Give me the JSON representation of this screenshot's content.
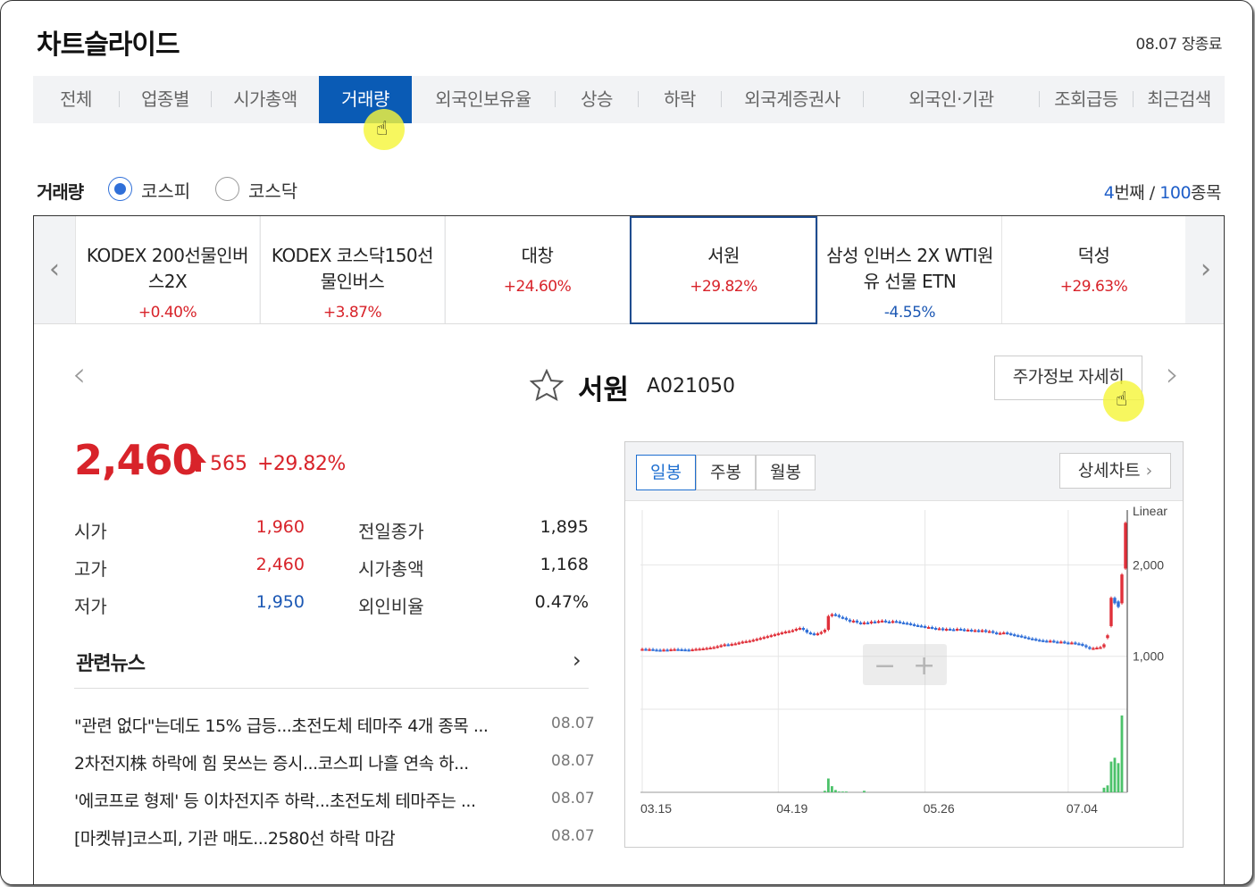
{
  "page_title": "차트슬라이드",
  "market_status": "08.07 장종료",
  "tabs": [
    {
      "label": "전체"
    },
    {
      "label": "업종별"
    },
    {
      "label": "시가총액"
    },
    {
      "label": "거래량",
      "active": true
    },
    {
      "label": "외국인보유율"
    },
    {
      "label": "상승"
    },
    {
      "label": "하락"
    },
    {
      "label": "외국계증권사"
    },
    {
      "label": "외국인·기관"
    },
    {
      "label": "조회급등"
    },
    {
      "label": "최근검색"
    }
  ],
  "filter": {
    "label": "거래량",
    "options": [
      {
        "label": "코스피",
        "checked": true
      },
      {
        "label": "코스닥",
        "checked": false
      }
    ],
    "rank_current": "4",
    "rank_suffix": "번째 / ",
    "rank_total": "100",
    "rank_unit": "종목"
  },
  "carousel": [
    {
      "name": "KODEX 200선물인버스2X",
      "change": "+0.40%",
      "dir": "up"
    },
    {
      "name": "KODEX 코스닥150선물인버스",
      "change": "+3.87%",
      "dir": "up"
    },
    {
      "name": "대창",
      "change": "+24.60%",
      "dir": "up"
    },
    {
      "name": "서원",
      "change": "+29.82%",
      "dir": "up",
      "selected": true
    },
    {
      "name": "삼성 인버스 2X WTI원유 선물 ETN",
      "change": "-4.55%",
      "dir": "down"
    },
    {
      "name": "덕성",
      "change": "+29.63%",
      "dir": "up"
    }
  ],
  "stock": {
    "name": "서원",
    "code": "A021050",
    "detail_button": "주가정보 자세히",
    "price": "2,460",
    "change_amount": "565",
    "change_pct": "+29.82%",
    "quotes": [
      {
        "label": "시가",
        "value": "1,960",
        "color": "up"
      },
      {
        "label": "고가",
        "value": "2,460",
        "color": "up"
      },
      {
        "label": "저가",
        "value": "1,950",
        "color": "down"
      },
      {
        "label": "전일종가",
        "value": "1,895",
        "color": "flat"
      },
      {
        "label": "시가총액",
        "value": "1,168",
        "color": "flat"
      },
      {
        "label": "외인비율",
        "value": "0.47%",
        "color": "flat"
      }
    ]
  },
  "news": {
    "heading": "관련뉴스",
    "items": [
      {
        "title": "\"관련 없다\"는데도 15% 급등...초전도체 테마주 4개 종목 ...",
        "date": "08.07"
      },
      {
        "title": "2차전지株 하락에 힘 못쓰는 증시...코스피 나흘 연속 하...",
        "date": "08.07"
      },
      {
        "title": "'에코프로 형제' 등 이차전지주 하락...초전도체 테마주는 ...",
        "date": "08.07"
      },
      {
        "title": "[마켓뷰]코스피, 기관 매도...2580선 하락 마감",
        "date": "08.07"
      }
    ]
  },
  "chart": {
    "periods": [
      "일봉",
      "주봉",
      "월봉"
    ],
    "active_period": "일봉",
    "detail_label": "상세차트",
    "scale_label": "Linear",
    "colors": {
      "up": "#e0303a",
      "down": "#2f6fd8",
      "volume": "#4cc26a"
    }
  },
  "chart_data": {
    "type": "candlestick",
    "x_ticks": [
      "03.15",
      "04.19",
      "05.26",
      "07.04"
    ],
    "y_ticks": [
      2000,
      1000
    ],
    "ylim": [
      450,
      2600
    ],
    "closes": [
      1080,
      1075,
      1078,
      1072,
      1070,
      1068,
      1072,
      1070,
      1075,
      1078,
      1076,
      1074,
      1072,
      1070,
      1075,
      1080,
      1082,
      1085,
      1090,
      1095,
      1100,
      1110,
      1120,
      1130,
      1125,
      1135,
      1140,
      1150,
      1160,
      1165,
      1170,
      1180,
      1190,
      1200,
      1210,
      1220,
      1230,
      1240,
      1250,
      1260,
      1270,
      1275,
      1285,
      1300,
      1310,
      1290,
      1260,
      1250,
      1240,
      1250,
      1265,
      1290,
      1440,
      1460,
      1450,
      1430,
      1420,
      1400,
      1380,
      1390,
      1370,
      1360,
      1370,
      1365,
      1380,
      1375,
      1385,
      1390,
      1380,
      1375,
      1385,
      1380,
      1370,
      1365,
      1360,
      1350,
      1340,
      1335,
      1330,
      1320,
      1320,
      1310,
      1300,
      1305,
      1290,
      1300,
      1295,
      1290,
      1300,
      1295,
      1285,
      1290,
      1280,
      1285,
      1275,
      1285,
      1270,
      1275,
      1260,
      1250,
      1255,
      1260,
      1250,
      1240,
      1230,
      1225,
      1215,
      1205,
      1195,
      1190,
      1180,
      1175,
      1170,
      1165,
      1170,
      1160,
      1155,
      1160,
      1150,
      1145,
      1150,
      1140,
      1135,
      1120,
      1100,
      1085,
      1090,
      1095,
      1100,
      1130,
      1230,
      1640,
      1580,
      1540,
      1895,
      2460
    ],
    "opens": [
      1075,
      1080,
      1075,
      1078,
      1072,
      1070,
      1068,
      1072,
      1070,
      1075,
      1078,
      1076,
      1074,
      1072,
      1070,
      1075,
      1080,
      1082,
      1085,
      1090,
      1095,
      1100,
      1110,
      1120,
      1130,
      1125,
      1135,
      1140,
      1150,
      1160,
      1165,
      1170,
      1180,
      1190,
      1200,
      1210,
      1220,
      1230,
      1240,
      1250,
      1260,
      1270,
      1275,
      1285,
      1300,
      1310,
      1290,
      1260,
      1250,
      1240,
      1250,
      1265,
      1290,
      1440,
      1460,
      1450,
      1430,
      1420,
      1400,
      1380,
      1390,
      1370,
      1360,
      1370,
      1365,
      1380,
      1375,
      1385,
      1390,
      1380,
      1375,
      1385,
      1380,
      1370,
      1365,
      1360,
      1350,
      1340,
      1335,
      1330,
      1320,
      1320,
      1310,
      1300,
      1305,
      1290,
      1300,
      1295,
      1290,
      1300,
      1295,
      1285,
      1290,
      1280,
      1285,
      1275,
      1285,
      1270,
      1275,
      1260,
      1250,
      1255,
      1260,
      1250,
      1240,
      1230,
      1225,
      1215,
      1205,
      1195,
      1190,
      1180,
      1175,
      1170,
      1165,
      1170,
      1160,
      1155,
      1160,
      1150,
      1145,
      1150,
      1140,
      1135,
      1120,
      1100,
      1085,
      1090,
      1095,
      1100,
      1200,
      1330,
      1640,
      1600,
      1580,
      1960
    ],
    "volumes": [
      0,
      0,
      0,
      0,
      0,
      0,
      0,
      0,
      0,
      0,
      0,
      0,
      0,
      0,
      0,
      0,
      0,
      0,
      0,
      0,
      0,
      0,
      0,
      0,
      0,
      0,
      0,
      0,
      0,
      0,
      0,
      0,
      0,
      0,
      0,
      0,
      0,
      0,
      0,
      0,
      0,
      0,
      0,
      0,
      0,
      0,
      0,
      0,
      0,
      0,
      0,
      2,
      18,
      8,
      3,
      1,
      1,
      1,
      0,
      0,
      0,
      0,
      2,
      0,
      0,
      0,
      0,
      0,
      0,
      0,
      0,
      0,
      0,
      0,
      0,
      0,
      0,
      0,
      0,
      0,
      0,
      0,
      0,
      0,
      0,
      0,
      0,
      0,
      0,
      0,
      0,
      0,
      0,
      0,
      0,
      0,
      0,
      0,
      0,
      0,
      0,
      0,
      0,
      0,
      0,
      0,
      0,
      0,
      0,
      0,
      0,
      0,
      0,
      0,
      0,
      0,
      0,
      0,
      0,
      0,
      0,
      0,
      0,
      0,
      0,
      0,
      0,
      0,
      0,
      6,
      9,
      40,
      45,
      38,
      100
    ]
  }
}
